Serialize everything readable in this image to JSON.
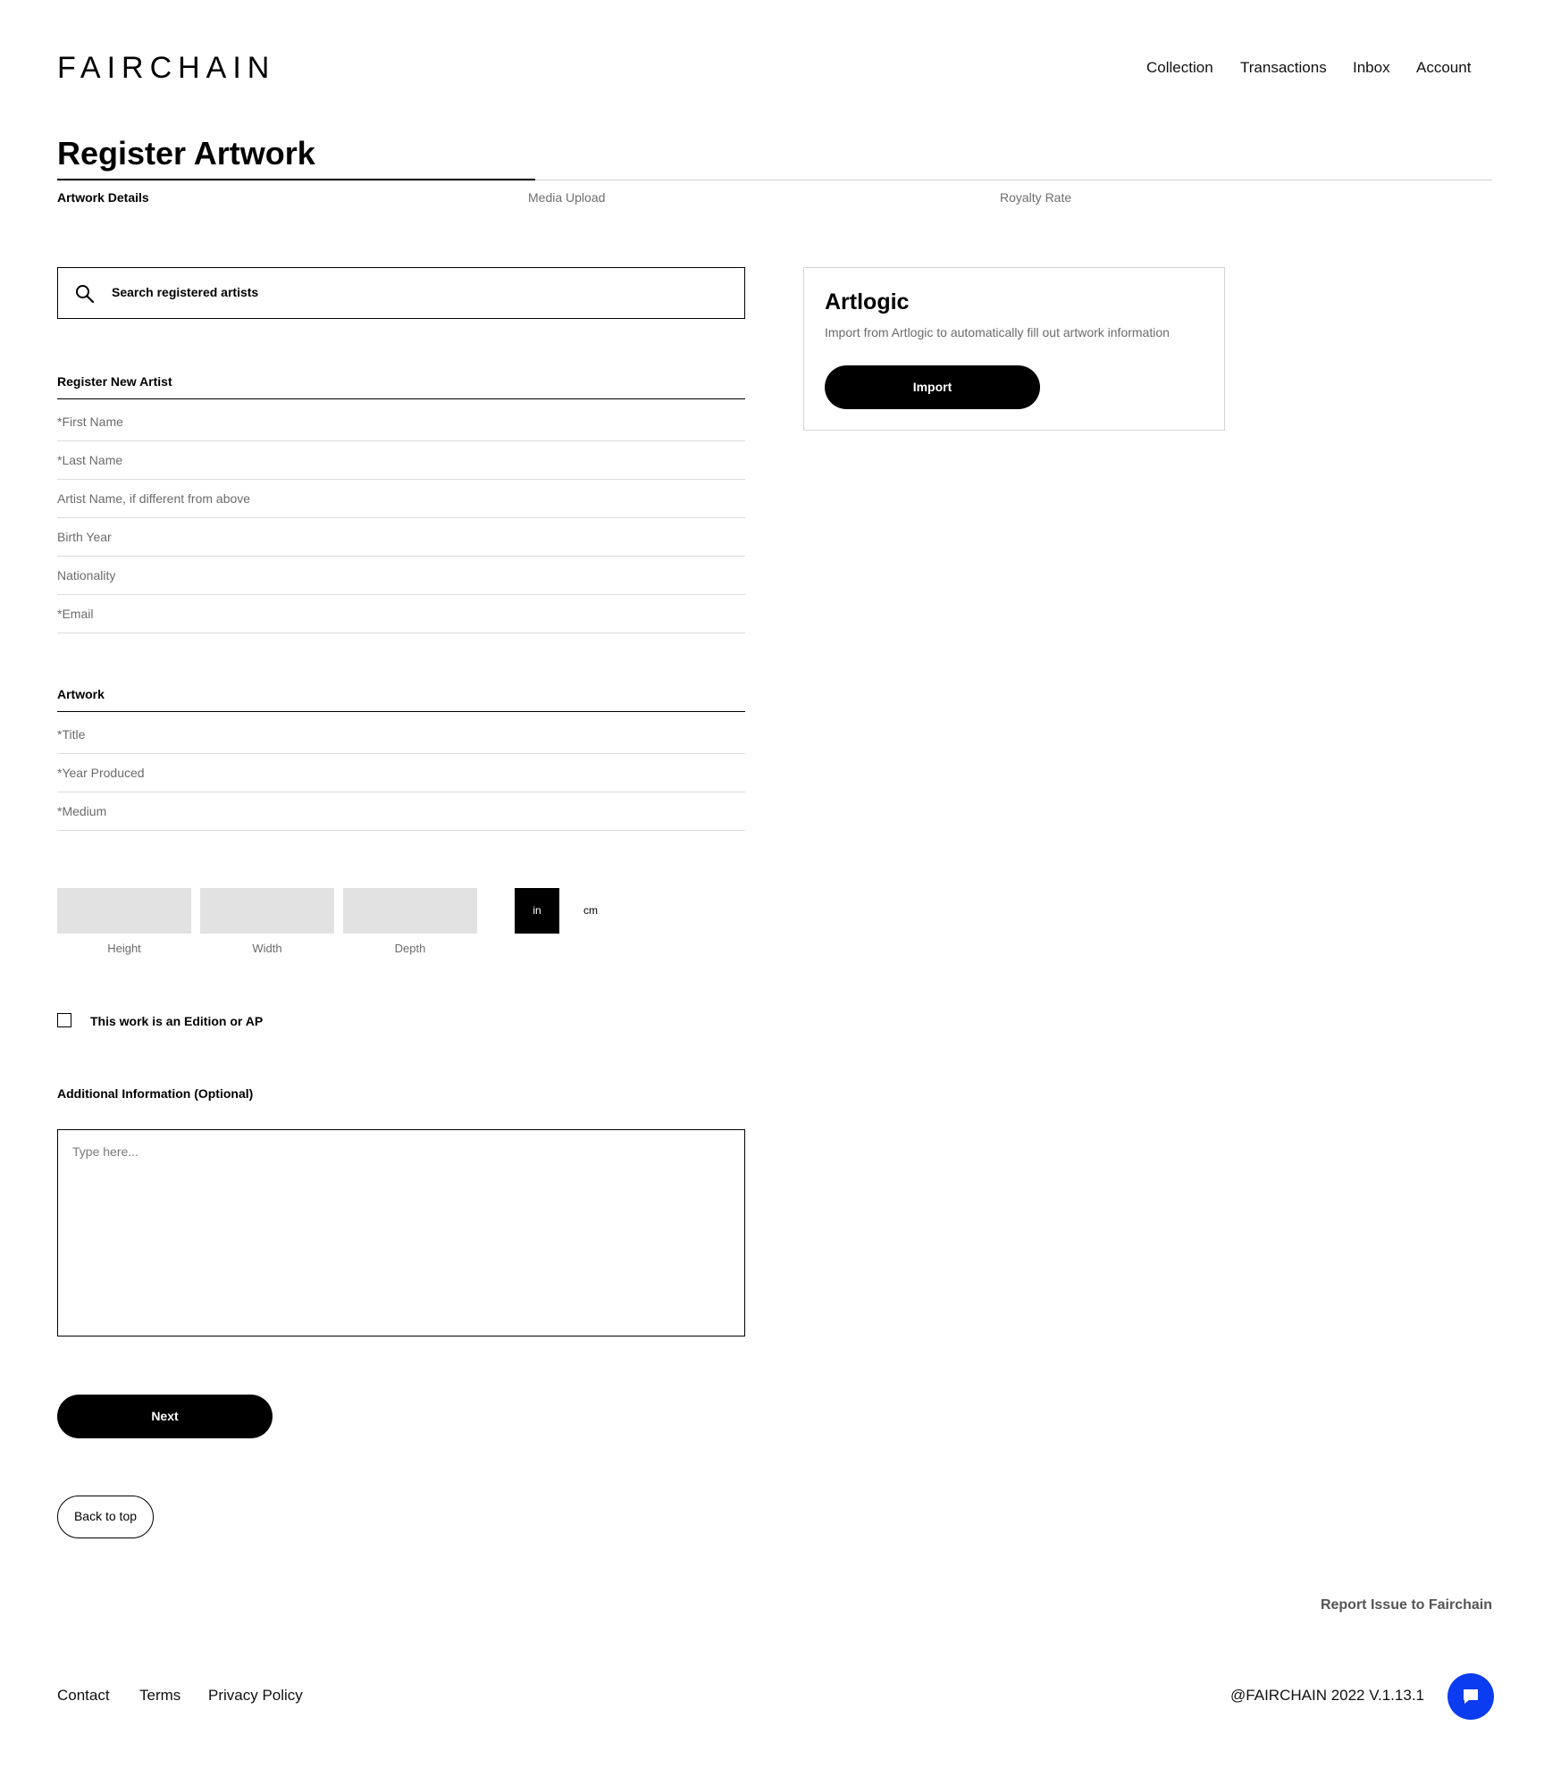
{
  "brand": {
    "logo_text": "FAIRCHAIN"
  },
  "nav": {
    "collection": "Collection",
    "transactions": "Transactions",
    "inbox": "Inbox",
    "account": "Account"
  },
  "page": {
    "title": "Register Artwork"
  },
  "steps": {
    "step1": "Artwork Details",
    "step2": "Media Upload",
    "step3": "Royalty Rate",
    "active_step": 1
  },
  "search": {
    "placeholder": "Search registered artists"
  },
  "artist_section": {
    "heading": "Register New Artist",
    "fields": {
      "first_name": "*First Name",
      "last_name": "*Last Name",
      "artist_name": "Artist Name, if different from above",
      "birth_year": "Birth Year",
      "nationality": "Nationality",
      "email": "*Email"
    }
  },
  "artwork_section": {
    "heading": "Artwork",
    "fields": {
      "title": "*Title",
      "year": "*Year Produced",
      "medium": "*Medium"
    }
  },
  "dimensions": {
    "height": "Height",
    "width": "Width",
    "depth": "Depth",
    "unit_in": "in",
    "unit_cm": "cm",
    "selected_unit": "in"
  },
  "edition": {
    "label": "This work is an Edition or AP",
    "checked": false
  },
  "additional": {
    "label": "Additional Information (Optional)",
    "placeholder": "Type here..."
  },
  "actions": {
    "next": "Next",
    "back_to_top": "Back to top"
  },
  "artlogic": {
    "title": "Artlogic",
    "description": "Import from Artlogic to automatically fill out artwork information",
    "import": "Import"
  },
  "footer": {
    "report": "Report Issue to Fairchain",
    "contact": "Contact",
    "terms": "Terms",
    "privacy": "Privacy Policy",
    "copyright": "@FAIRCHAIN 2022 V.1.13.1"
  },
  "colors": {
    "primary": "#000000",
    "chat_button": "#0b3cf0",
    "input_fill": "#e2e2e2"
  }
}
